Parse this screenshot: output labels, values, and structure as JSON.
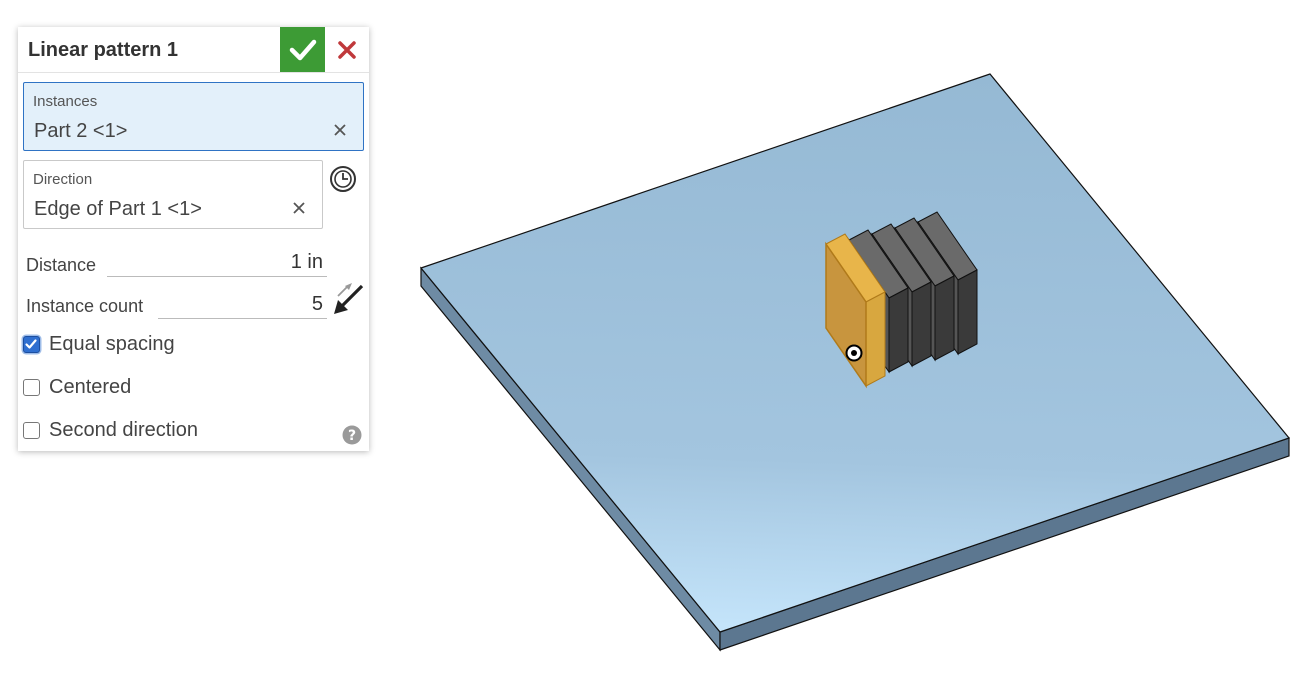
{
  "feature_dialog": {
    "title": "Linear pattern 1",
    "accept_icon": "check-icon",
    "cancel_icon": "close-icon",
    "instances": {
      "label": "Instances",
      "value": "Part 2 <1>"
    },
    "direction": {
      "label": "Direction",
      "value": "Edge of Part 1 <1>"
    },
    "distance": {
      "label": "Distance",
      "value": "1 in"
    },
    "instance_count": {
      "label": "Instance count",
      "value": "5"
    },
    "options": [
      {
        "label": "Equal spacing",
        "checked": true
      },
      {
        "label": "Centered",
        "checked": false
      },
      {
        "label": "Second direction",
        "checked": false
      }
    ]
  },
  "colors": {
    "accept": "#3d9b35",
    "cancel": "#c0393b",
    "active_field_bg": "#e3f0fa",
    "plate_top": "#9bbfd9",
    "plate_side": "#5f7a92",
    "selected_part": "#c8953e",
    "fin": "#4a4a4a"
  }
}
